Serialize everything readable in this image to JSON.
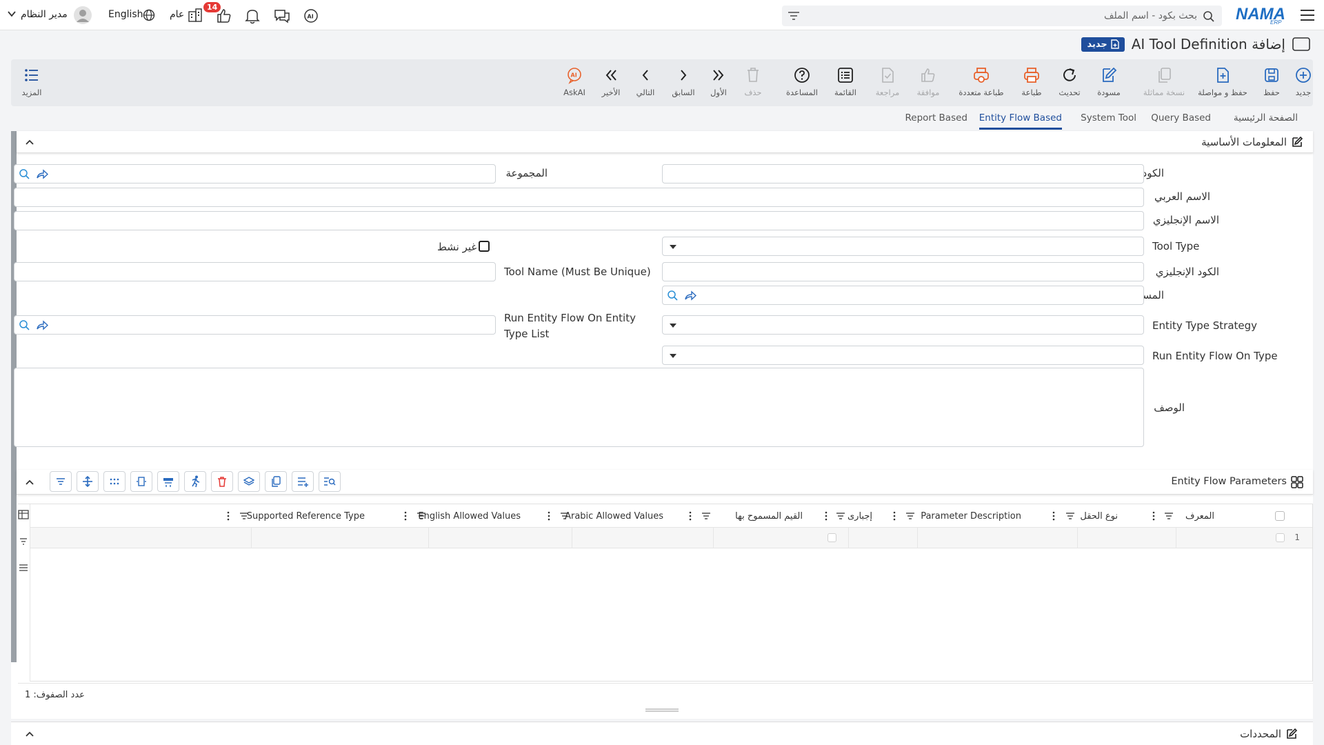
{
  "topbar": {
    "search_placeholder": "بحث بكود - اسم الملف",
    "user_name": "مدير النظام",
    "language": "English",
    "scope": "عام",
    "notification_count": "14"
  },
  "title": {
    "text": "إضافة AI Tool Definition",
    "badge": "جديد"
  },
  "toolbar": {
    "new": "جديد",
    "save": "حفظ",
    "save_continue": "حفظ و مواصلة",
    "duplicate": "نسخة مماثلة",
    "draft": "مسودة",
    "refresh": "تحديث",
    "print": "طباعة",
    "multi_print": "طباعة متعددة",
    "approve": "موافقة",
    "review": "مراجعة",
    "list": "القائمة",
    "help": "المساعدة",
    "delete": "حذف",
    "first": "الأول",
    "previous": "السابق",
    "next": "التالي",
    "last": "الأخير",
    "askai": "AskAI",
    "more": "المزيد"
  },
  "tabs": [
    "الصفحة الرئيسية",
    "Query Based",
    "System Tool",
    "Entity Flow Based",
    "Report Based"
  ],
  "basic_info": {
    "title": "المعلومات الأساسية",
    "code_label": "الكود",
    "group_label": "المجموعة",
    "arabic_name_label": "الاسم العربي",
    "english_name_label": "الاسم الإنجليزي",
    "tool_type_label": "Tool Type",
    "inactive_label": "غير نشط",
    "english_code_label": "الكود الإنجليزي",
    "tool_name_label": "Tool Name (Must Be Unique)",
    "path_label": "المسار",
    "entity_type_strategy_label": "Entity Type Strategy",
    "run_on_entity_type_list_label": "Run Entity Flow On Entity Type List",
    "run_on_type_label": "Run Entity Flow On Type",
    "description_label": "الوصف"
  },
  "parameters": {
    "title": "Entity Flow Parameters",
    "columns": [
      "المعرف",
      "نوع الحقل",
      "Parameter Description",
      "إجبارى",
      "القيم المسموح بها",
      "Arabic Allowed Values",
      "English Allowed Values",
      "Supported Reference Type"
    ],
    "row_number": "1",
    "row_count_text": "عدد الصفوف: 1"
  },
  "determinants": {
    "title": "المحددات"
  },
  "colors": {
    "accent": "#1f4e9c",
    "danger": "#e53935",
    "orange": "#e8622c",
    "icon_blue": "#2a6bbf"
  }
}
